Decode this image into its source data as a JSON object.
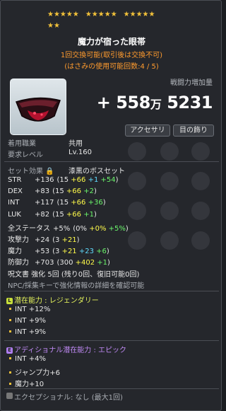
{
  "stars": {
    "filled": 17,
    "total": 17
  },
  "item": {
    "name": "魔力が宿った眼帯",
    "line1": "1回交換可能(取引後は交換不可)",
    "line2": "(はさみの使用可能回数:4 / 5)",
    "power_label": "戦闘力増加量",
    "power_value_man": "+ 558",
    "power_man_unit": "万",
    "power_value_rest": "5231",
    "tag_accessory": "アクセサリ",
    "tag_eye": "目の飾り"
  },
  "req": {
    "job_label": "着用職業",
    "job_value": "共用",
    "level_label": "要求レベル",
    "level_value": "Lv.160"
  },
  "set": {
    "label": "セット効果",
    "name": "漆黒のボスセット"
  },
  "stats": [
    {
      "name": "STR",
      "value": "+136",
      "paren": [
        {
          "t": "(15 ",
          "c": "lbl"
        },
        {
          "t": "+66",
          "c": "yel"
        },
        {
          "t": " ",
          "c": "lbl"
        },
        {
          "t": "+1",
          "c": "cyn"
        },
        {
          "t": " ",
          "c": "lbl"
        },
        {
          "t": "+54",
          "c": "grn"
        },
        {
          "t": ")",
          "c": "lbl"
        }
      ]
    },
    {
      "name": "DEX",
      "value": "+83",
      "paren": [
        {
          "t": "(15 ",
          "c": "lbl"
        },
        {
          "t": "+66",
          "c": "yel"
        },
        {
          "t": " ",
          "c": "lbl"
        },
        {
          "t": "+2",
          "c": "grn"
        },
        {
          "t": ")",
          "c": "lbl"
        }
      ]
    },
    {
      "name": "INT",
      "value": "+117",
      "paren": [
        {
          "t": "(15 ",
          "c": "lbl"
        },
        {
          "t": "+66",
          "c": "yel"
        },
        {
          "t": " ",
          "c": "lbl"
        },
        {
          "t": "+36",
          "c": "grn"
        },
        {
          "t": ")",
          "c": "lbl"
        }
      ]
    },
    {
      "name": "LUK",
      "value": "+82",
      "paren": [
        {
          "t": "(15 ",
          "c": "lbl"
        },
        {
          "t": "+66",
          "c": "yel"
        },
        {
          "t": " ",
          "c": "lbl"
        },
        {
          "t": "+1",
          "c": "grn"
        },
        {
          "t": ")",
          "c": "lbl"
        }
      ]
    },
    {
      "name": "全ステータス",
      "value": "+5%",
      "paren": [
        {
          "t": "(0% ",
          "c": "lbl"
        },
        {
          "t": "+0%",
          "c": "yel"
        },
        {
          "t": " ",
          "c": "lbl"
        },
        {
          "t": "+5%",
          "c": "grn"
        },
        {
          "t": ")",
          "c": "lbl"
        }
      ]
    },
    {
      "name": "攻撃力",
      "value": "+24",
      "paren": [
        {
          "t": "(3 ",
          "c": "lbl"
        },
        {
          "t": "+21",
          "c": "yel"
        },
        {
          "t": ")",
          "c": "lbl"
        }
      ]
    },
    {
      "name": "魔力",
      "value": "+53",
      "paren": [
        {
          "t": "(3 ",
          "c": "lbl"
        },
        {
          "t": "+21",
          "c": "yel"
        },
        {
          "t": " ",
          "c": "lbl"
        },
        {
          "t": "+23",
          "c": "cyn"
        },
        {
          "t": " ",
          "c": "lbl"
        },
        {
          "t": "+6",
          "c": "grn"
        },
        {
          "t": ")",
          "c": "lbl"
        }
      ]
    },
    {
      "name": "防御力",
      "value": "+703",
      "paren": [
        {
          "t": "(300 ",
          "c": "lbl"
        },
        {
          "t": "+402",
          "c": "yel"
        },
        {
          "t": " ",
          "c": "lbl"
        },
        {
          "t": "+1",
          "c": "grn"
        },
        {
          "t": ")",
          "c": "lbl"
        }
      ]
    }
  ],
  "scroll": {
    "line": "呪文書 強化 5回 (残り0回、復旧可能0回)",
    "npc_hint": "NPC/採集キーで強化情報の詳細を確認可能"
  },
  "potential": {
    "badge": "L",
    "label": "潜在能力 : レジェンダリー",
    "lines": [
      "INT +12%",
      "INT +9%",
      "INT +9%"
    ],
    "color": "#e4f35b"
  },
  "additional": {
    "badge": "E",
    "label": "アディショナル潜在能力 : エピック",
    "lines": [
      "INT +4%",
      "ジャンプ力+6",
      "魔力+10"
    ],
    "color": "#c08af5"
  },
  "exceptional": {
    "label": "エクセプショナル: なし (最大1回)"
  }
}
